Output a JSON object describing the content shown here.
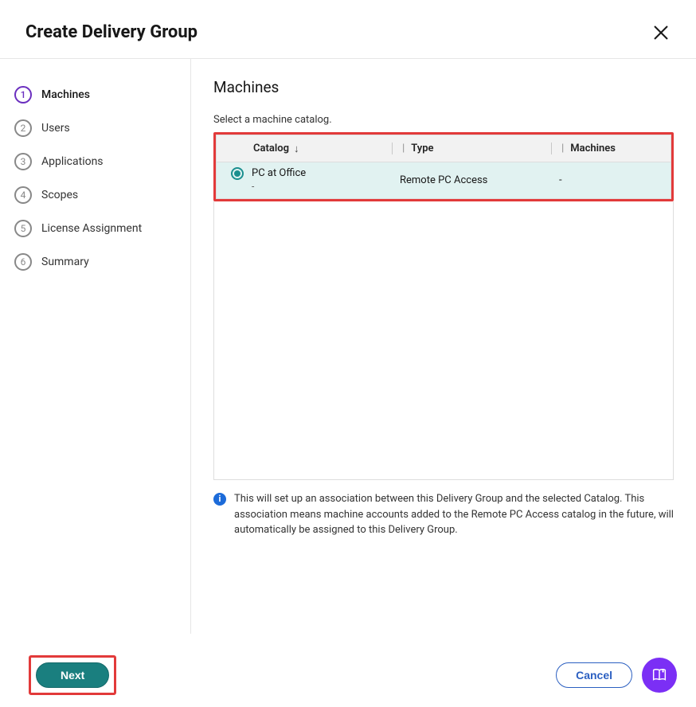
{
  "header": {
    "title": "Create Delivery Group"
  },
  "sidebar": {
    "steps": [
      {
        "num": "1",
        "label": "Machines",
        "active": true
      },
      {
        "num": "2",
        "label": "Users",
        "active": false
      },
      {
        "num": "3",
        "label": "Applications",
        "active": false
      },
      {
        "num": "4",
        "label": "Scopes",
        "active": false
      },
      {
        "num": "5",
        "label": "License Assignment",
        "active": false
      },
      {
        "num": "6",
        "label": "Summary",
        "active": false
      }
    ]
  },
  "main": {
    "title": "Machines",
    "subtitle": "Select a machine catalog.",
    "columns": {
      "catalog": "Catalog",
      "type": "Type",
      "machines": "Machines"
    },
    "rows": [
      {
        "selected": true,
        "catalog_name": "PC at Office",
        "catalog_sub": "-",
        "type": "Remote PC Access",
        "machines": "-"
      }
    ],
    "info": "This will set up an association between this Delivery Group and the selected Catalog. This association means machine accounts added to the Remote PC Access catalog in the future, will automatically be assigned to this Delivery Group."
  },
  "footer": {
    "next": "Next",
    "cancel": "Cancel"
  }
}
